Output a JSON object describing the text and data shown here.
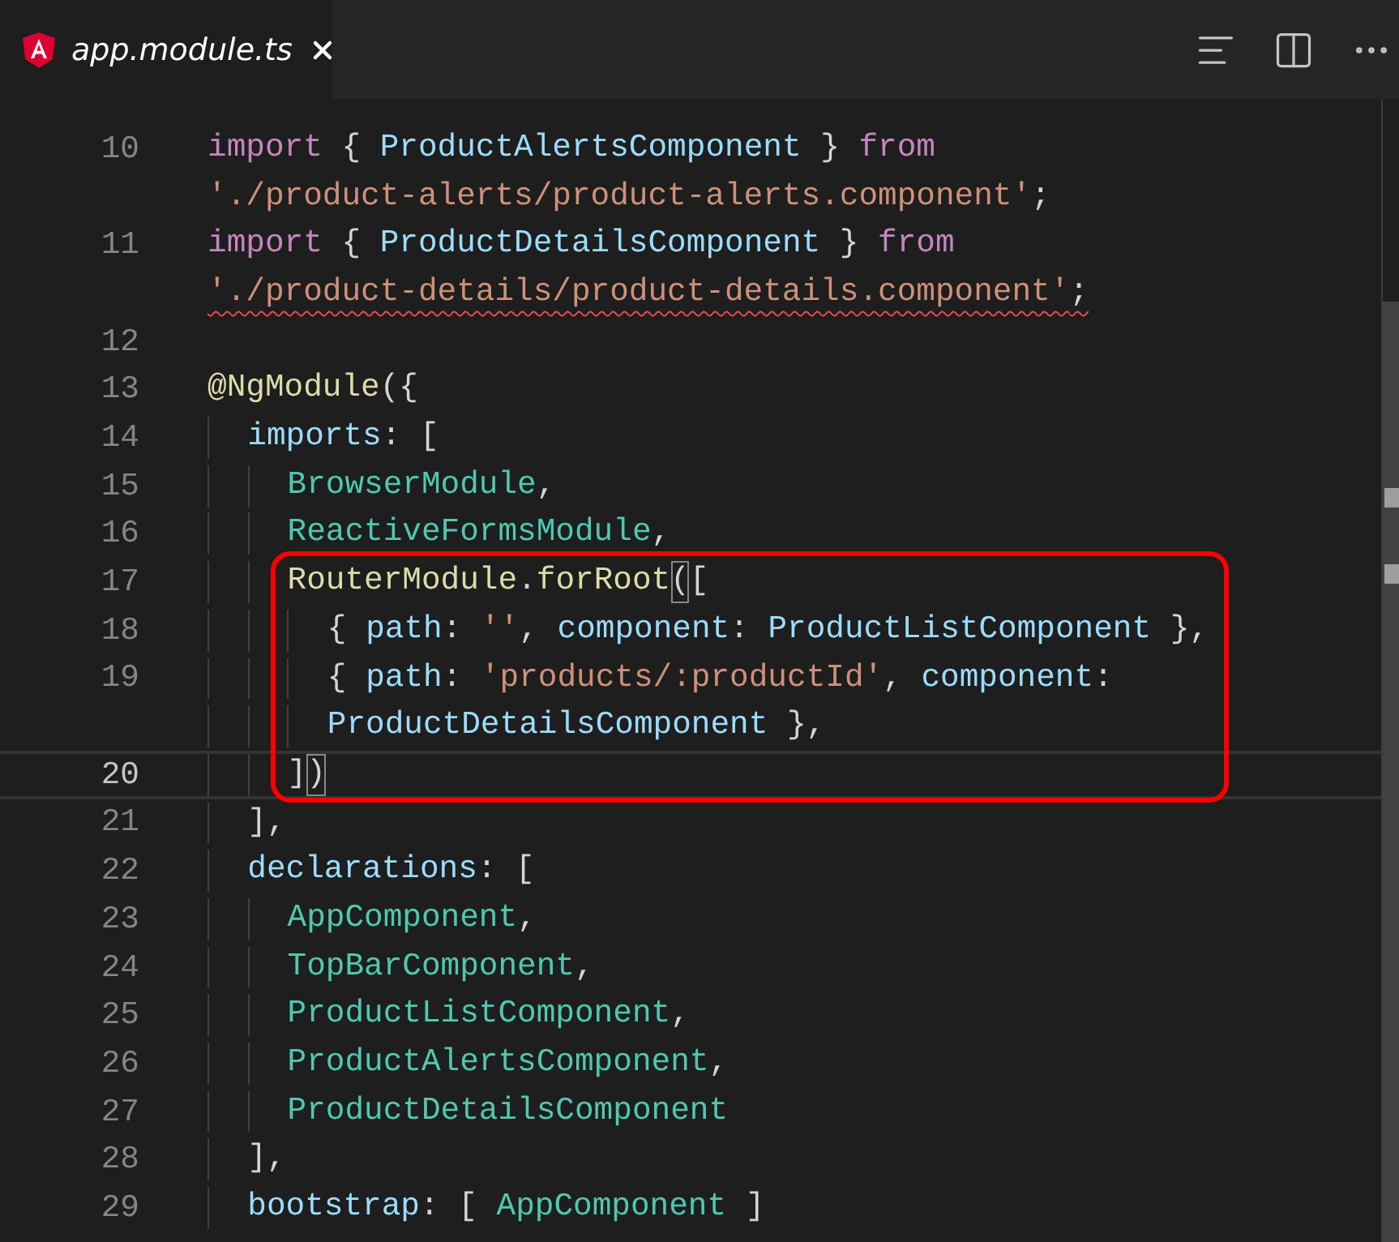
{
  "tab": {
    "title": "app.module.ts",
    "preview": true
  },
  "lines": [
    {
      "number": "10",
      "active": false,
      "boxed": false,
      "tokens": [
        {
          "kind": "keyword",
          "text": "import"
        },
        {
          "kind": "punct",
          "text": " { "
        },
        {
          "kind": "variable",
          "text": "ProductAlertsComponent"
        },
        {
          "kind": "punct",
          "text": " } "
        },
        {
          "kind": "keyword",
          "text": "from"
        }
      ]
    },
    {
      "active": false,
      "boxed": false,
      "tokens": [
        {
          "kind": "string",
          "text": "'./product-alerts/product-alerts.component'"
        },
        {
          "kind": "punct",
          "text": ";"
        }
      ]
    },
    {
      "number": "11",
      "active": false,
      "boxed": false,
      "tokens": [
        {
          "kind": "keyword",
          "text": "import"
        },
        {
          "kind": "punct",
          "text": " { "
        },
        {
          "kind": "variable",
          "text": "ProductDetailsComponent"
        },
        {
          "kind": "punct",
          "text": " } "
        },
        {
          "kind": "keyword",
          "text": "from"
        }
      ]
    },
    {
      "active": false,
      "boxed": false,
      "tokens": [
        {
          "kind": "string",
          "text": "'./product-details/product-details.component'",
          "error": true
        },
        {
          "kind": "punct",
          "text": ";",
          "error": true
        }
      ]
    },
    {
      "number": "12",
      "active": false,
      "boxed": false
    },
    {
      "number": "13",
      "active": false,
      "boxed": false,
      "tokens": [
        {
          "kind": "function",
          "text": "@NgModule"
        },
        {
          "kind": "punct",
          "text": "({"
        }
      ]
    },
    {
      "number": "14",
      "active": false,
      "boxed": false,
      "tokens": [
        {
          "kind": "variable",
          "text": "  imports"
        },
        {
          "kind": "punct",
          "text": ": ["
        }
      ]
    },
    {
      "number": "15",
      "active": false,
      "boxed": false,
      "tokens": [
        {
          "kind": "class",
          "text": "    BrowserModule"
        },
        {
          "kind": "punct",
          "text": ","
        }
      ]
    },
    {
      "number": "16",
      "active": false,
      "boxed": false,
      "tokens": [
        {
          "kind": "class",
          "text": "    ReactiveFormsModule"
        },
        {
          "kind": "punct",
          "text": ","
        }
      ]
    },
    {
      "number": "17",
      "active": false,
      "boxed": true,
      "tokens": [
        {
          "kind": "function",
          "text": "    RouterModule"
        },
        {
          "kind": "punct",
          "text": "."
        },
        {
          "kind": "function",
          "text": "forRoot"
        },
        {
          "kind": "bracket",
          "text": "("
        },
        {
          "kind": "punct",
          "text": "["
        }
      ]
    },
    {
      "number": "18",
      "active": false,
      "boxed": true,
      "tokens": [
        {
          "kind": "punct",
          "text": "      { "
        },
        {
          "kind": "variable",
          "text": "path"
        },
        {
          "kind": "punct",
          "text": ": "
        },
        {
          "kind": "string",
          "text": "''"
        },
        {
          "kind": "punct",
          "text": ", "
        },
        {
          "kind": "variable",
          "text": "component"
        },
        {
          "kind": "punct",
          "text": ": "
        },
        {
          "kind": "variable",
          "text": "ProductListComponent"
        },
        {
          "kind": "punct",
          "text": " },"
        }
      ]
    },
    {
      "number": "19",
      "active": false,
      "boxed": true,
      "tokens": [
        {
          "kind": "punct",
          "text": "      { "
        },
        {
          "kind": "variable",
          "text": "path"
        },
        {
          "kind": "punct",
          "text": ": "
        },
        {
          "kind": "string",
          "text": "'products/:productId'"
        },
        {
          "kind": "punct",
          "text": ", "
        },
        {
          "kind": "variable",
          "text": "component"
        },
        {
          "kind": "punct",
          "text": ":"
        }
      ]
    },
    {
      "active": false,
      "boxed": true,
      "tokens": [
        {
          "kind": "variable",
          "text": "      ProductDetailsComponent"
        },
        {
          "kind": "punct",
          "text": " },"
        }
      ]
    },
    {
      "number": "20",
      "active": true,
      "boxed": true,
      "tokens": [
        {
          "kind": "punct",
          "text": "    ]"
        },
        {
          "kind": "bracket",
          "text": ")"
        }
      ]
    },
    {
      "number": "21",
      "active": false,
      "boxed": false,
      "tokens": [
        {
          "kind": "punct",
          "text": "  ],"
        }
      ]
    },
    {
      "number": "22",
      "active": false,
      "boxed": false,
      "tokens": [
        {
          "kind": "variable",
          "text": "  declarations"
        },
        {
          "kind": "punct",
          "text": ": ["
        }
      ]
    },
    {
      "number": "23",
      "active": false,
      "boxed": false,
      "tokens": [
        {
          "kind": "class",
          "text": "    AppComponent"
        },
        {
          "kind": "punct",
          "text": ","
        }
      ]
    },
    {
      "number": "24",
      "active": false,
      "boxed": false,
      "tokens": [
        {
          "kind": "class",
          "text": "    TopBarComponent"
        },
        {
          "kind": "punct",
          "text": ","
        }
      ]
    },
    {
      "number": "25",
      "active": false,
      "boxed": false,
      "tokens": [
        {
          "kind": "class",
          "text": "    ProductListComponent"
        },
        {
          "kind": "punct",
          "text": ","
        }
      ]
    },
    {
      "number": "26",
      "active": false,
      "boxed": false,
      "tokens": [
        {
          "kind": "class",
          "text": "    ProductAlertsComponent"
        },
        {
          "kind": "punct",
          "text": ","
        }
      ]
    },
    {
      "number": "27",
      "active": false,
      "boxed": false,
      "tokens": [
        {
          "kind": "class",
          "text": "    ProductDetailsComponent"
        }
      ]
    },
    {
      "number": "28",
      "active": false,
      "boxed": false,
      "tokens": [
        {
          "kind": "punct",
          "text": "  ],"
        }
      ]
    },
    {
      "number": "29",
      "active": false,
      "boxed": false,
      "tokens": [
        {
          "kind": "variable",
          "text": "  bootstrap"
        },
        {
          "kind": "punct",
          "text": ": [ "
        },
        {
          "kind": "class",
          "text": "AppComponent"
        },
        {
          "kind": "punct",
          "text": " ]"
        }
      ]
    }
  ]
}
